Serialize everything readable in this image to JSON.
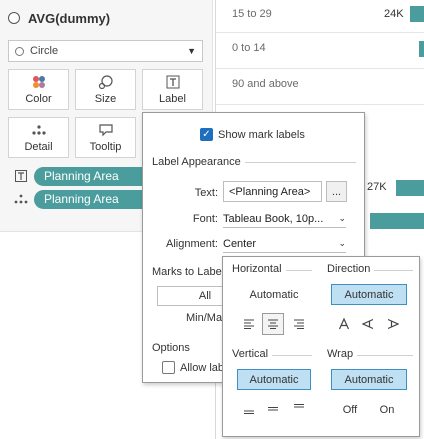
{
  "marks_card": {
    "measure_title": "AVG(dummy)",
    "mark_type": {
      "selected": "Circle",
      "icon": "circle-icon"
    },
    "tiles": [
      {
        "label": "Color",
        "icon": "color-dots-icon"
      },
      {
        "label": "Size",
        "icon": "size-icon"
      },
      {
        "label": "Label",
        "icon": "label-T-icon"
      },
      {
        "label": "Detail",
        "icon": "detail-dots-icon"
      },
      {
        "label": "Tooltip",
        "icon": "tooltip-icon"
      }
    ],
    "pills": [
      {
        "label": "Planning Area",
        "icon": "label-T-icon",
        "color": "#4b9c9c"
      },
      {
        "label": "Planning Area",
        "icon": "detail-dots-icon",
        "color": "#4b9c9c"
      }
    ]
  },
  "view": {
    "rows": [
      "15 to 29",
      "0 to 14",
      "90 and above"
    ],
    "bar_labels": [
      "24K",
      "27K"
    ],
    "bar_color": "#4b9c9c"
  },
  "label_dialog": {
    "show_mark_labels": {
      "label": "Show mark labels",
      "checked": true
    },
    "appearance_title": "Label Appearance",
    "text_label": "Text:",
    "text_value": "<Planning Area>",
    "text_button": "...",
    "font_label": "Font:",
    "font_value": "Tableau Book, 10p...",
    "alignment_label": "Alignment:",
    "alignment_value": "Center",
    "marks_to_label_title": "Marks to Label",
    "all_button": "All",
    "minmax_label": "Min/Max",
    "options_title": "Options",
    "allow_label": "Allow lab",
    "allow_checked": false
  },
  "align_popup": {
    "horizontal_title": "Horizontal",
    "direction_title": "Direction",
    "horizontal_auto": "Automatic",
    "direction_auto": "Automatic",
    "horizontal_icons": [
      "align-left-icon",
      "align-center-icon",
      "align-right-icon"
    ],
    "horizontal_selected": "align-center-icon",
    "direction_icons": [
      "text-up-icon",
      "text-rotate-left-icon",
      "text-rotate-right-icon"
    ],
    "vertical_title": "Vertical",
    "wrap_title": "Wrap",
    "vertical_auto": "Automatic",
    "wrap_auto": "Automatic",
    "vertical_icons": [
      "align-bottom-icon",
      "align-middle-icon",
      "align-top-icon"
    ],
    "wrap_off": "Off",
    "wrap_on": "On",
    "selected_color": "#bfe0f2"
  }
}
